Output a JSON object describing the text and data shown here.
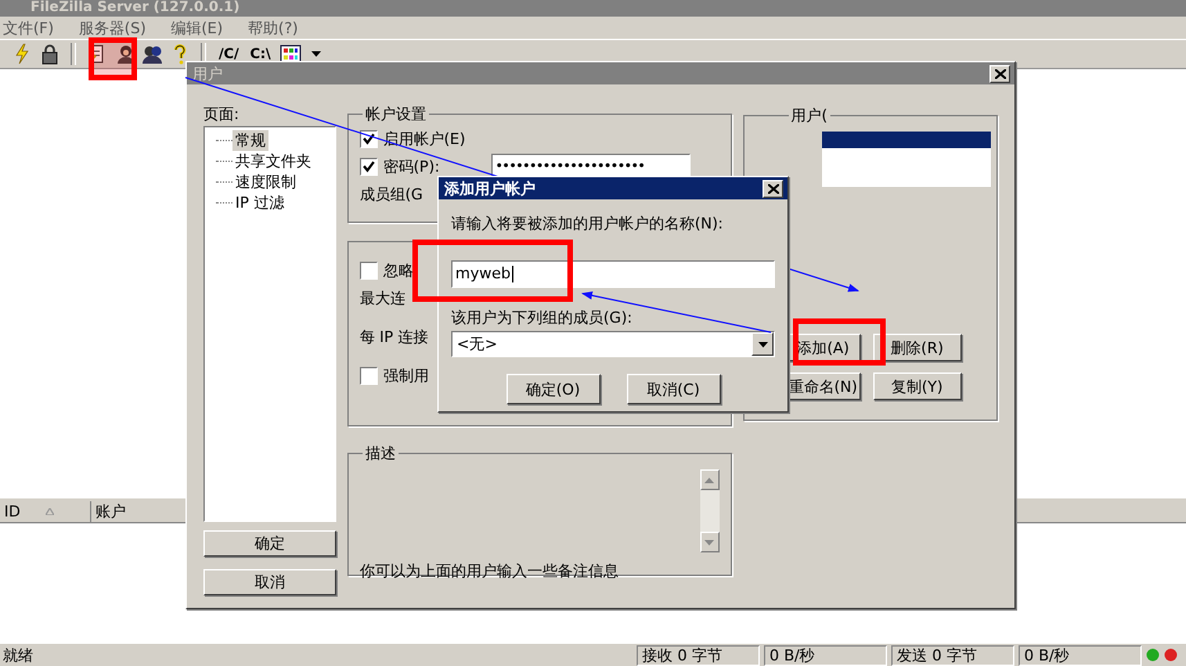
{
  "window": {
    "title": "FileZilla Server (127.0.0.1)"
  },
  "menu": [
    {
      "label": "文件(F)"
    },
    {
      "label": "服务器(S)"
    },
    {
      "label": "编辑(E)"
    },
    {
      "label": "帮助(?)"
    }
  ],
  "toolbar": {
    "drive_labels": [
      "/C/",
      "C:\\"
    ]
  },
  "user_list": {
    "columns": [
      "ID",
      "账户"
    ]
  },
  "status_bar": {
    "message": "就绪",
    "fields": [
      "接收 0 字节",
      "0 B/秒",
      "发送 0 字节",
      "0 B/秒"
    ]
  },
  "users_dialog": {
    "title": "用户",
    "active": false,
    "pages_label": "页面:",
    "pages": [
      {
        "label": "常规",
        "selected": true
      },
      {
        "label": "共享文件夹",
        "selected": false
      },
      {
        "label": "速度限制",
        "selected": false
      },
      {
        "label": "IP 过滤",
        "selected": false
      }
    ],
    "ok": "确定",
    "cancel": "取消",
    "account_group": {
      "title": "帐户设置",
      "enable": {
        "label": "启用帐户(E)",
        "checked": true
      },
      "password": {
        "label": "密码(P):",
        "checked": true,
        "value": "••••••••••••••••••••••"
      },
      "group_label": "成员组(G"
    },
    "limits_group": {
      "ignore": {
        "label": "忽略",
        "checked": false
      },
      "max_connections_label": "最大连",
      "per_ip_label": "每 IP 连接",
      "force": {
        "label": "强制用",
        "checked": false
      }
    },
    "description_group": {
      "title": "描述",
      "hint": "你可以为上面的用户输入一些备注信息"
    },
    "users_group": {
      "title": "用户(",
      "rows": [
        {
          "selected": true
        }
      ]
    },
    "buttons": [
      "添加(A)",
      "删除(R)",
      "重命名(N)",
      "复制(Y)"
    ]
  },
  "add_user_dialog": {
    "title": "添加用户帐户",
    "active": true,
    "name_label": "请输入将要被添加的用户帐户的名称(N):",
    "name_value": "myweb",
    "group_label": "该用户为下列组的成员(G):",
    "group_value": "<无>",
    "ok": "确定(O)",
    "cancel": "取消(C)"
  }
}
